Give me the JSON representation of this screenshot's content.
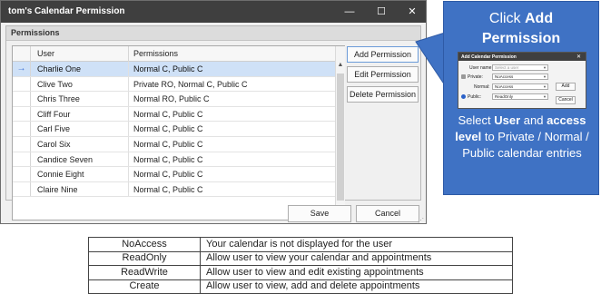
{
  "window": {
    "title": "tom's Calendar Permission",
    "minimize_glyph": "—",
    "maximize_glyph": "☐",
    "close_glyph": "✕"
  },
  "group": {
    "title": "Permissions"
  },
  "grid": {
    "columns": [
      "User",
      "Permissions"
    ],
    "selected_indicator": "→",
    "rows": [
      {
        "user": "Charlie One",
        "permissions": "Normal C, Public C",
        "selected": true
      },
      {
        "user": "Clive Two",
        "permissions": "Private RO, Normal C, Public C"
      },
      {
        "user": "Chris Three",
        "permissions": "Normal RO, Public C"
      },
      {
        "user": "Cliff Four",
        "permissions": "Normal C, Public C"
      },
      {
        "user": "Carl Five",
        "permissions": "Normal C, Public C"
      },
      {
        "user": "Carol Six",
        "permissions": "Normal C, Public C"
      },
      {
        "user": "Candice Seven",
        "permissions": "Normal C, Public C"
      },
      {
        "user": "Connie Eight",
        "permissions": "Normal C, Public C"
      },
      {
        "user": "Claire Nine",
        "permissions": "Normal C, Public C"
      }
    ]
  },
  "buttons": {
    "add_permission": "Add Permission",
    "edit_permission": "Edit Permission",
    "delete_permission": "Delete Permission",
    "save": "Save",
    "cancel": "Cancel"
  },
  "callout": {
    "title_prefix": "Click ",
    "title_bold1": "Add",
    "title_bold2": "Permission",
    "desc_1": "Select ",
    "desc_user": "User",
    "desc_2": " and ",
    "desc_access": "access level",
    "desc_3": " to Private / Normal / Public calendar entries",
    "mini_dialog": {
      "title": "Add Calendar Permission",
      "user_label": "User name:",
      "user_placeholder": "Select a user",
      "private_label": "Private:",
      "private_value": "NoAccess",
      "normal_label": "Normal:",
      "normal_value": "NoAccess",
      "public_label": "Public:",
      "public_value": "ReadOnly",
      "add_button": "Add",
      "cancel_button": "Cancel"
    }
  },
  "access_levels": [
    {
      "level": "NoAccess",
      "description": "Your calendar is not displayed for the user"
    },
    {
      "level": "ReadOnly",
      "description": "Allow user to view your calendar and appointments"
    },
    {
      "level": "ReadWrite",
      "description": "Allow user to view and edit existing appointments"
    },
    {
      "level": "Create",
      "description": "Allow user to view, add and delete appointments"
    }
  ],
  "colors": {
    "titlebar": "#3f3f3f",
    "callout_bg": "#3f72c4",
    "selected_row": "#cfe1f7",
    "indicator": "#3b6fd6"
  }
}
